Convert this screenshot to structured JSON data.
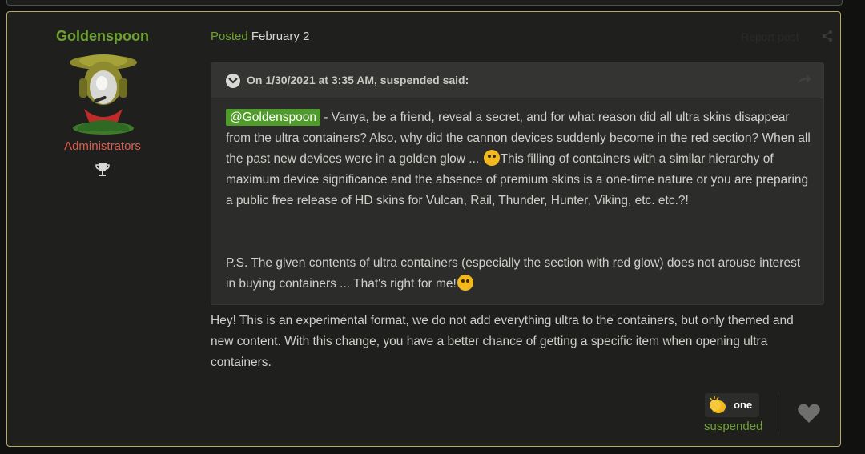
{
  "post": {
    "author": {
      "name": "Goldenspoon",
      "role": "Administrators",
      "avatar_icon": "robot-soldier-avatar",
      "badge_icon": "trophy-icon"
    },
    "posted_label": "Posted",
    "posted_date": "February 2",
    "report_label": "Report post",
    "quote": {
      "citation": "On 1/30/2021 at 3:35 AM, suspended said:",
      "mention": "@Goldenspoon",
      "paragraph1_part1": " - Vanya, be a friend, reveal a secret, and for what reason did all ultra skins disappear from the ultra containers? Also, why did the cannon devices suddenly become in the red section? When all the past new devices were in a golden glow ... ",
      "paragraph1_part2": "This filling of containers with a similar hierarchy of maximum device significance and the absence of premium skins is a one-time nature or you are preparing a public free release of HD skins for Vulcan, Rail, Thunder, Hunter, Viking, etc. etc.?!",
      "paragraph2": "P.S. The given contents of ultra containers (especially the section with red glow) does not arouse interest in buying containers ... That's right for me!"
    },
    "reply": "Hey! This is an experimental format, we do not add everything ultra to the containers, but only themed and new content. With this change, you have a better chance of getting a specific item when opening ultra containers.",
    "reaction": {
      "icon": "clapping-hands-icon",
      "count_label": "one",
      "reactor": "suspended"
    },
    "colors": {
      "accent_green": "#6da233",
      "admin_red": "#e25b4d",
      "border_gold": "#b9aa68",
      "mention_bg": "#4f9c2a"
    }
  }
}
